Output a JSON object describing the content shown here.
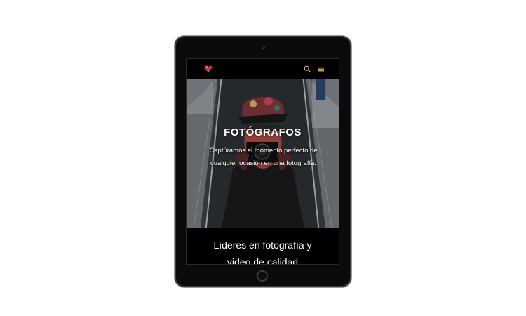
{
  "header": {
    "logo_icon": "colorful-heart-logo-icon",
    "search_icon": "search-icon",
    "menu_icon": "hamburger-menu-icon",
    "colors": {
      "background": "#000000",
      "icon": "#e8c547"
    }
  },
  "hero": {
    "title": "FOTÓGRAFOS",
    "text": "Captúramos el momento perfecto de cualquier ocasión en una fotografía."
  },
  "section": {
    "heading": "Líderes en fotografía y\nvideo de calidad"
  }
}
